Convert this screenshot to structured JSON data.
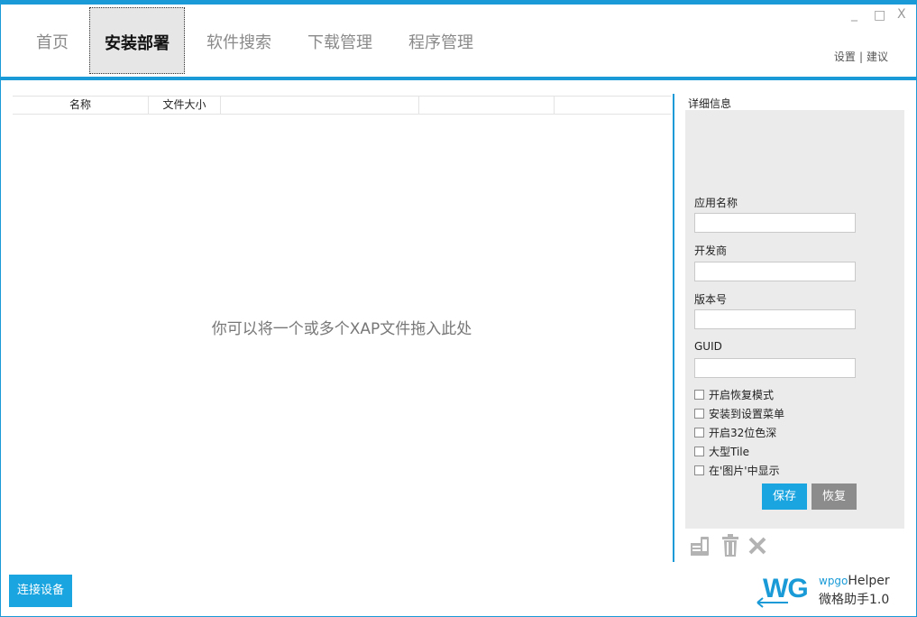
{
  "nav": {
    "tabs": [
      {
        "label": "首页"
      },
      {
        "label": "安装部署"
      },
      {
        "label": "软件搜索"
      },
      {
        "label": "下载管理"
      },
      {
        "label": "程序管理"
      }
    ],
    "settings_label": "设置",
    "separator": "|",
    "feedback_label": "建议"
  },
  "window": {
    "minimize": "_",
    "maximize": "□",
    "close": "X"
  },
  "list": {
    "columns": [
      "名称",
      "文件大小",
      "",
      "",
      ""
    ],
    "drop_hint": "你可以将一个或多个XAP文件拖入此处"
  },
  "details": {
    "title": "详细信息",
    "app_name_label": "应用名称",
    "app_name_value": "",
    "developer_label": "开发商",
    "developer_value": "",
    "version_label": "版本号",
    "version_value": "",
    "guid_label": "GUID",
    "guid_value": "",
    "options": [
      {
        "label": "开启恢复模式",
        "checked": false
      },
      {
        "label": "安装到设置菜单",
        "checked": false
      },
      {
        "label": "开启32位色深",
        "checked": false
      },
      {
        "label": "大型Tile",
        "checked": false
      },
      {
        "label": "在'图片'中显示",
        "checked": false
      }
    ],
    "save_label": "保存",
    "restore_label": "恢复",
    "tool_icons": [
      "device-icon",
      "trash-icon",
      "close-icon"
    ]
  },
  "footer": {
    "connect_label": "连接设备",
    "logo_wg": "WG",
    "logo_wpgo": "wpgo",
    "logo_helper": "Helper",
    "logo_cn": "微格助手1.0"
  },
  "colors": {
    "accent": "#1a9bd7",
    "button_blue": "#1aa5e0",
    "button_gray": "#8c8c8c",
    "panel_bg": "#ebebeb"
  }
}
